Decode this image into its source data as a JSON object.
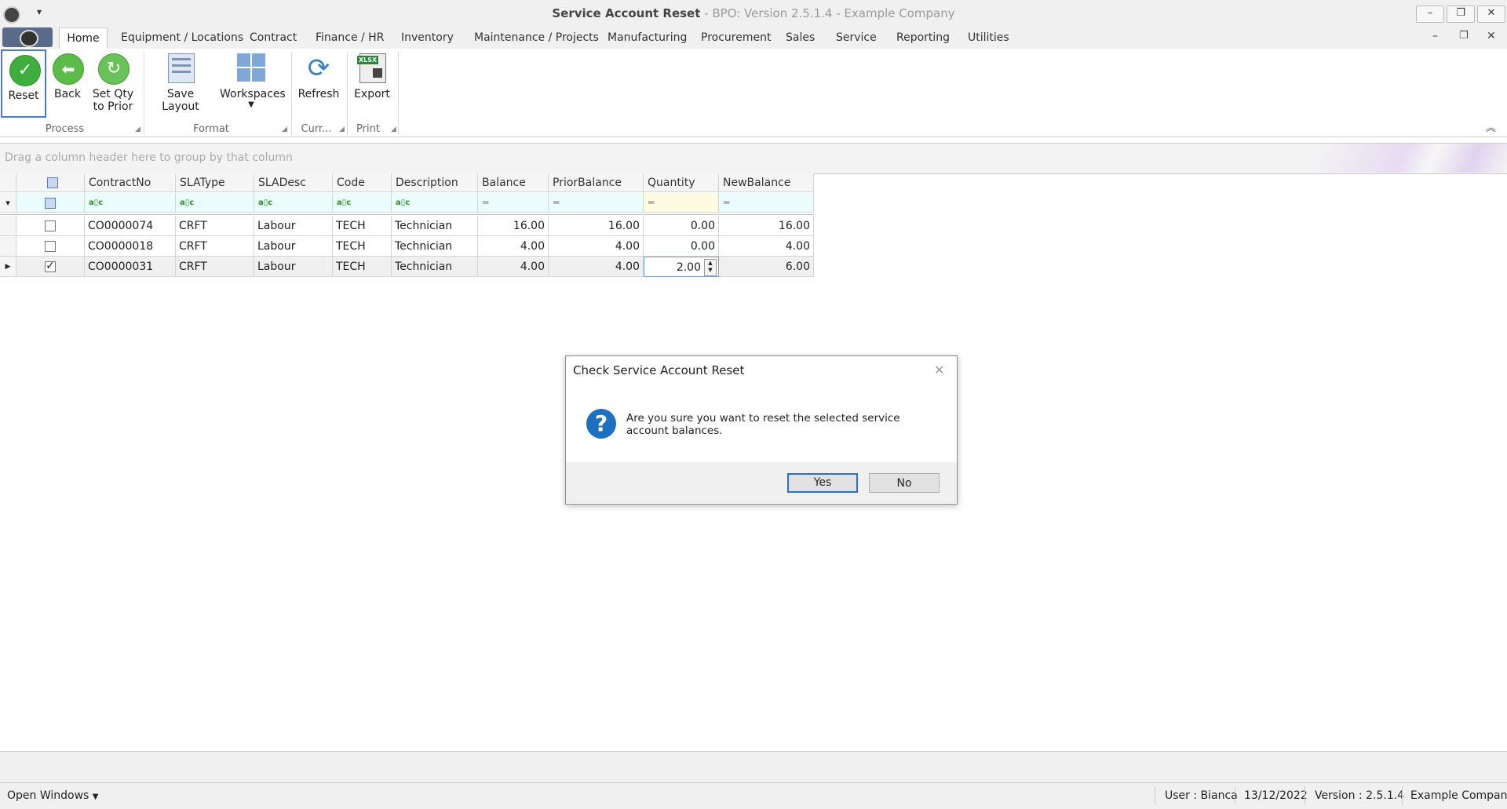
{
  "window": {
    "title_main": "Service Account Reset",
    "title_rest": " - BPO: Version 2.5.1.4 - Example Company",
    "controls": [
      "–",
      "❐",
      "✕"
    ],
    "mdi_controls": [
      "–",
      "❐",
      "✕"
    ]
  },
  "tabs": [
    {
      "label": "Home"
    },
    {
      "label": "Equipment / Locations"
    },
    {
      "label": "Contract"
    },
    {
      "label": "Finance / HR"
    },
    {
      "label": "Inventory"
    },
    {
      "label": "Maintenance / Projects"
    },
    {
      "label": "Manufacturing"
    },
    {
      "label": "Procurement"
    },
    {
      "label": "Sales"
    },
    {
      "label": "Service"
    },
    {
      "label": "Reporting"
    },
    {
      "label": "Utilities"
    }
  ],
  "ribbon": {
    "reset": "Reset",
    "back": "Back",
    "set_qty_1": "Set Qty",
    "set_qty_2": "to Prior",
    "save_layout": "Save Layout",
    "workspaces": "Workspaces",
    "refresh": "Refresh",
    "export": "Export",
    "export_badge": "XLSX",
    "groups": {
      "process": "Process",
      "format": "Format",
      "current": "Curr...",
      "print": "Print"
    }
  },
  "grid": {
    "group_hint": "Drag a column header here to group by that column",
    "columns": [
      "ContractNo",
      "SLAType",
      "SLADesc",
      "Code",
      "Description",
      "Balance",
      "PriorBalance",
      "Quantity",
      "NewBalance"
    ],
    "rows": [
      {
        "checked": false,
        "current": false,
        "cells": [
          "CO0000074",
          "CRFT",
          "Labour",
          "TECH",
          "Technician",
          "16.00",
          "16.00",
          "0.00",
          "16.00"
        ]
      },
      {
        "checked": false,
        "current": false,
        "cells": [
          "CO0000018",
          "CRFT",
          "Labour",
          "TECH",
          "Technician",
          "4.00",
          "4.00",
          "0.00",
          "4.00"
        ]
      },
      {
        "checked": true,
        "current": true,
        "cells": [
          "CO0000031",
          "CRFT",
          "Labour",
          "TECH",
          "Technician",
          "4.00",
          "4.00",
          "2.00",
          "6.00"
        ]
      }
    ]
  },
  "dialog": {
    "title": "Check Service Account Reset",
    "message": "Are you sure you want to reset the selected service account balances.",
    "yes": "Yes",
    "no": "No",
    "icon": "question-icon"
  },
  "status": {
    "open_windows": "Open Windows",
    "user": "User : Bianca",
    "date": "13/12/2022",
    "version": "Version : 2.5.1.4",
    "company": "Example Company"
  },
  "colors": {
    "accent": "#2a6fc0",
    "filter_row": "#eafcfb",
    "quantity_filter": "#fffbe0"
  }
}
